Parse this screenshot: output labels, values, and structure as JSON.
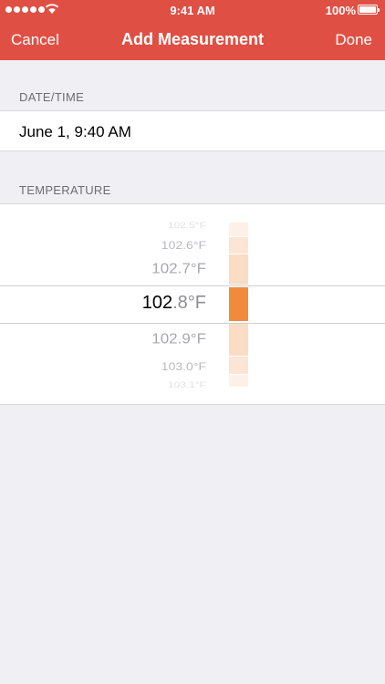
{
  "status_bar": {
    "time": "9:41 AM",
    "battery": "100%"
  },
  "nav": {
    "cancel": "Cancel",
    "title": "Add Measurement",
    "done": "Done"
  },
  "sections": {
    "datetime_header": "DATE/TIME",
    "datetime_value": "June 1, 9:40 AM",
    "temperature_header": "TEMPERATURE"
  },
  "picker": {
    "unit": "°F",
    "items": [
      {
        "whole": "102",
        "dec": ".5"
      },
      {
        "whole": "102",
        "dec": ".6"
      },
      {
        "whole": "102",
        "dec": ".7"
      },
      {
        "whole": "102",
        "dec": ".8"
      },
      {
        "whole": "102",
        "dec": ".9"
      },
      {
        "whole": "103",
        "dec": ".0"
      },
      {
        "whole": "103",
        "dec": ".1"
      }
    ],
    "selected_index": 3
  },
  "colors": {
    "nav": "#e04f44",
    "accent": "#f28a3c"
  }
}
